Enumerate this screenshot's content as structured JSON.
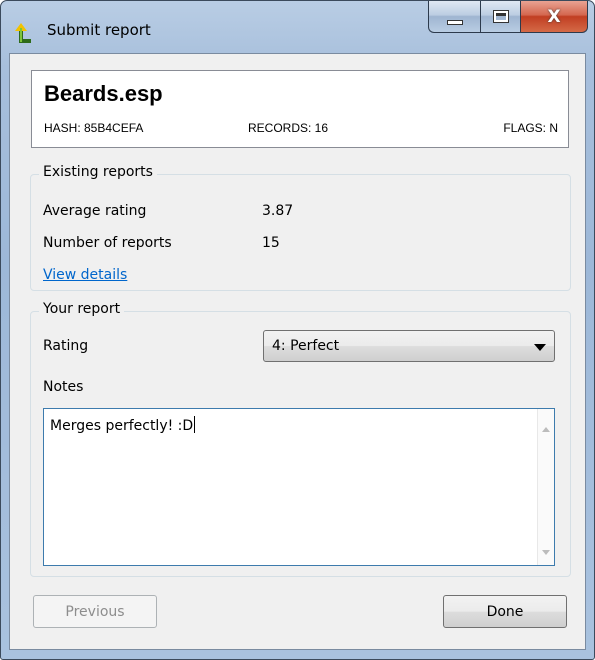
{
  "window": {
    "title": "Submit report"
  },
  "plugin": {
    "name": "Beards.esp",
    "hash_text": "HASH: 85B4CEFA",
    "records_text": "RECORDS: 16",
    "flags_text": "FLAGS: N"
  },
  "existing_reports": {
    "legend": "Existing reports",
    "average_rating_label": "Average rating",
    "average_rating_value": "3.87",
    "number_of_reports_label": "Number of reports",
    "number_of_reports_value": "15",
    "view_details_link": "View details"
  },
  "your_report": {
    "legend": "Your report",
    "rating_label": "Rating",
    "rating_selected": "4: Perfect",
    "notes_label": "Notes",
    "notes_value": "Merges perfectly!  :D"
  },
  "buttons": {
    "previous": "Previous",
    "done": "Done"
  },
  "icons": {
    "app": "app-icon",
    "minimize": "minimize-icon",
    "maximize": "maximize-icon",
    "close": "close-icon",
    "dropdown": "chevron-down-icon",
    "scroll_up": "scroll-up-icon",
    "scroll_down": "scroll-down-icon"
  }
}
